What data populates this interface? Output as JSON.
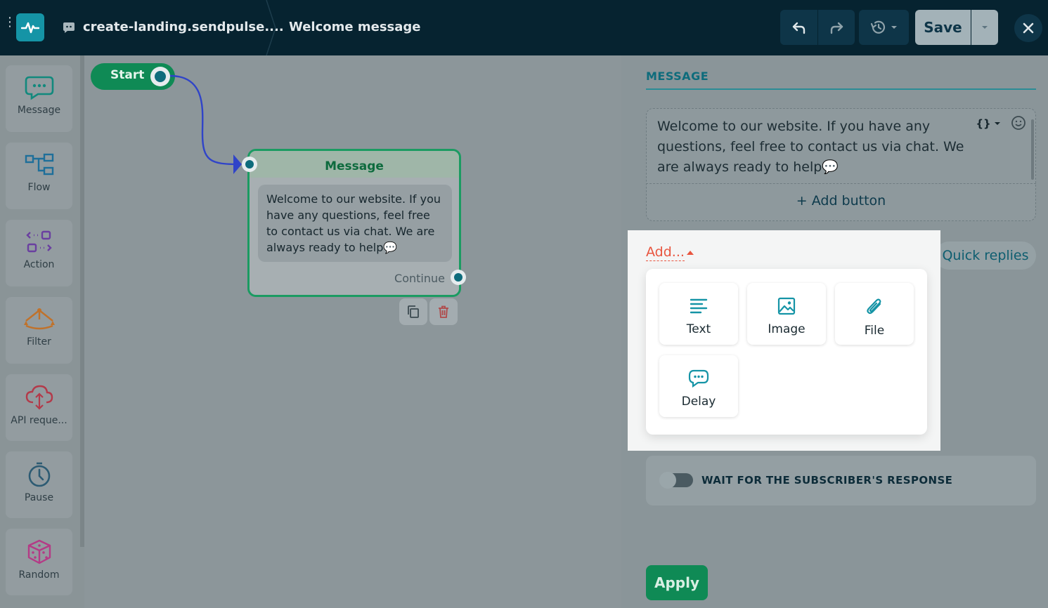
{
  "header": {
    "bot_name": "create-landing.sendpulse....",
    "flow_title": "Welcome message",
    "save_label": "Save"
  },
  "sidebar": {
    "items": [
      {
        "label": "Message",
        "icon": "chat-bubble-icon",
        "color": "#12897d"
      },
      {
        "label": "Flow",
        "icon": "flow-icon",
        "color": "#1e6f9a"
      },
      {
        "label": "Action",
        "icon": "action-icon",
        "color": "#6a3fa0"
      },
      {
        "label": "Filter",
        "icon": "filter-icon",
        "color": "#c0722b"
      },
      {
        "label": "API reque...",
        "icon": "api-cloud-icon",
        "color": "#b33a4a"
      },
      {
        "label": "Pause",
        "icon": "stopwatch-icon",
        "color": "#2d5b73"
      },
      {
        "label": "Random",
        "icon": "dice-icon",
        "color": "#b43b86"
      }
    ]
  },
  "canvas": {
    "start_label": "Start",
    "node": {
      "title": "Message",
      "text": "Welcome to our website. If you have any questions, feel free to contact us via chat. We are always ready to help💬",
      "continue_label": "Continue"
    }
  },
  "panel": {
    "tab_label": "MESSAGE",
    "editor_text": "Welcome to our website. If you have any questions, feel free to contact us via chat. We are always ready to help💬",
    "vars_label": "{}",
    "add_button_label": "+ Add button",
    "add_label": "Add...",
    "quick_replies_label": "Quick replies",
    "add_menu": [
      {
        "label": "Text",
        "icon": "text-lines-icon"
      },
      {
        "label": "Image",
        "icon": "image-icon"
      },
      {
        "label": "File",
        "icon": "paperclip-icon"
      },
      {
        "label": "Delay",
        "icon": "delay-bubble-icon"
      }
    ],
    "wait_label": "WAIT FOR THE SUBSCRIBER'S RESPONSE",
    "apply_label": "Apply"
  },
  "colors": {
    "topbar": "#062330",
    "accent_green": "#0f8a55",
    "accent_teal": "#1594a6",
    "add_orange": "#e8553f"
  }
}
